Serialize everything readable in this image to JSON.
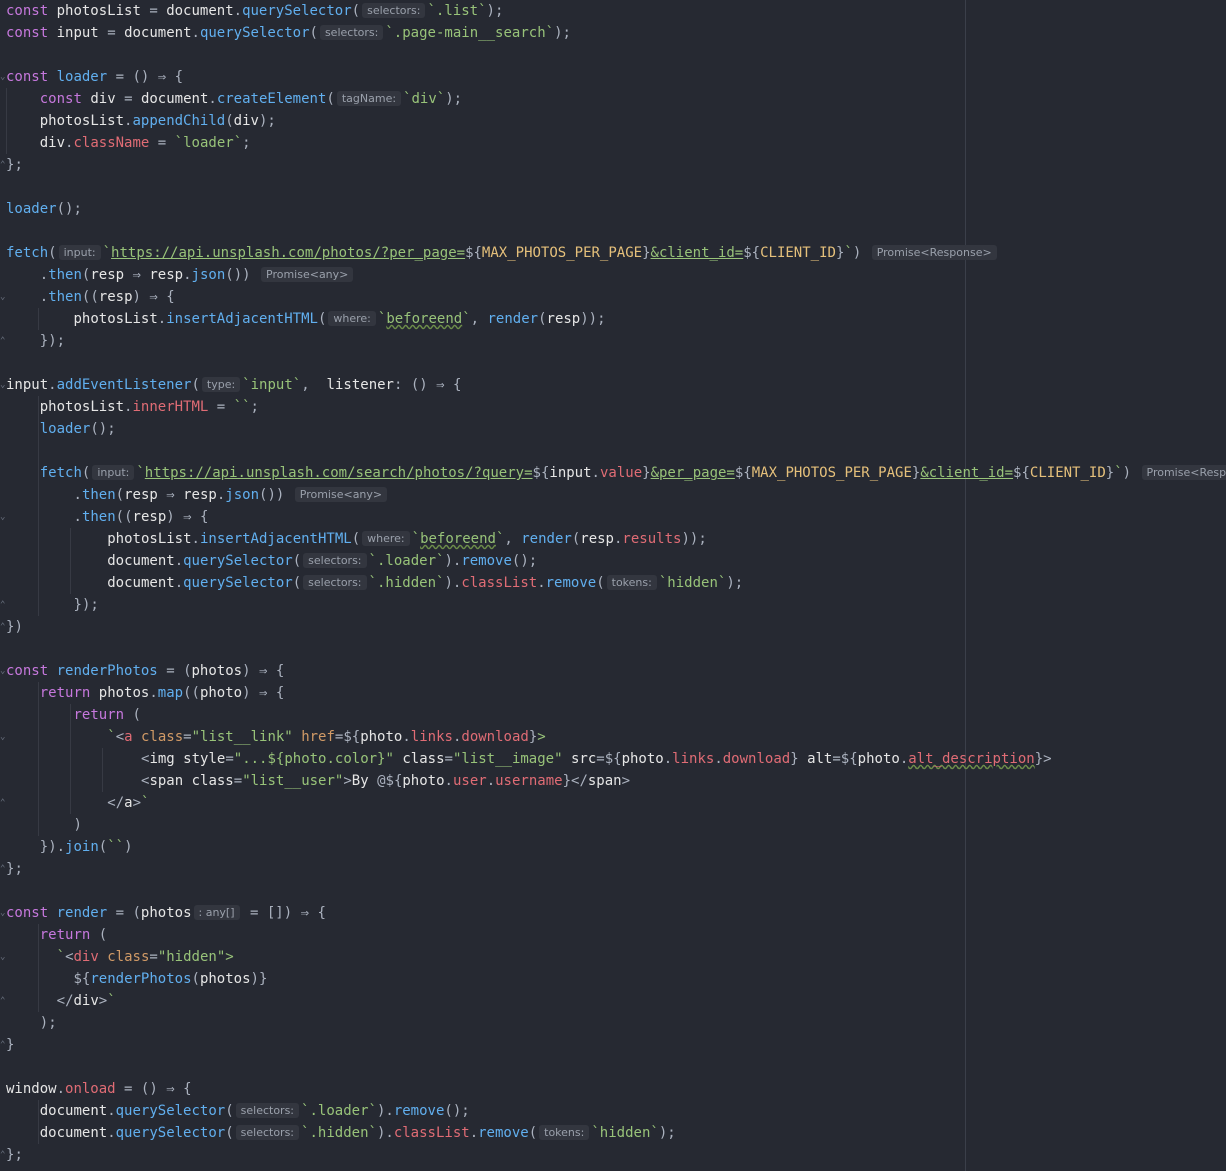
{
  "editor": {
    "language": "JavaScript",
    "lines": [
      "const photosList = document.querySelector( selectors: `.list`);",
      "const input = document.querySelector( selectors: `.page-main__search`);",
      "",
      "const loader = () ⇒ {",
      "    const div = document.createElement( tagName: `div`);",
      "    photosList.appendChild(div);",
      "    div.className = `loader`;",
      "};",
      "",
      "loader();",
      "",
      "fetch( input: `https://api.unsplash.com/photos/?per_page=${MAX_PHOTOS_PER_PAGE}&client_id=${CLIENT_ID}`) Promise<Response>",
      "    .then(resp ⇒ resp.json()) Promise<any>",
      "    .then((resp) ⇒ {",
      "        photosList.insertAdjacentHTML( where: `beforeend`, render(resp));",
      "    });",
      "",
      "input.addEventListener( type: `input`,  listener: () ⇒ {",
      "    photosList.innerHTML = ``;",
      "    loader();",
      "",
      "    fetch( input: `https://api.unsplash.com/search/photos/?query=${input.value}&per_page=${MAX_PHOTOS_PER_PAGE}&client_id=${CLIENT_ID}`) Promise<Response>",
      "        .then(resp ⇒ resp.json()) Promise<any>",
      "        .then((resp) ⇒ {",
      "            photosList.insertAdjacentHTML( where: `beforeend`, render(resp.results));",
      "            document.querySelector( selectors: `.loader`).remove();",
      "            document.querySelector( selectors: `.hidden`).classList.remove( tokens: `hidden`);",
      "        });",
      "})",
      "",
      "const renderPhotos = (photos) ⇒ {",
      "    return photos.map((photo) ⇒ {",
      "        return (",
      "            `<a class=\"list__link\" href=${photo.links.download}>",
      "                <img style=\"...${photo.color}\" class=\"list__image\" src=${photo.links.download} alt=${photo.alt_description}>",
      "                <span class=\"list__user\">By @${photo.user.username}</span>",
      "            </a>`",
      "        )",
      "    }).join(``)",
      "};",
      "",
      "const render = (photos : any[] = []) ⇒ {",
      "    return (",
      "      `<div class=\"hidden\">",
      "        ${renderPhotos(photos)}",
      "      </div>`",
      "    );",
      "}",
      "",
      "window.onload = () ⇒ {",
      "    document.querySelector( selectors: `.loader`).remove();",
      "    document.querySelector( selectors: `.hidden`).classList.remove( tokens: `hidden`);",
      "};"
    ]
  }
}
